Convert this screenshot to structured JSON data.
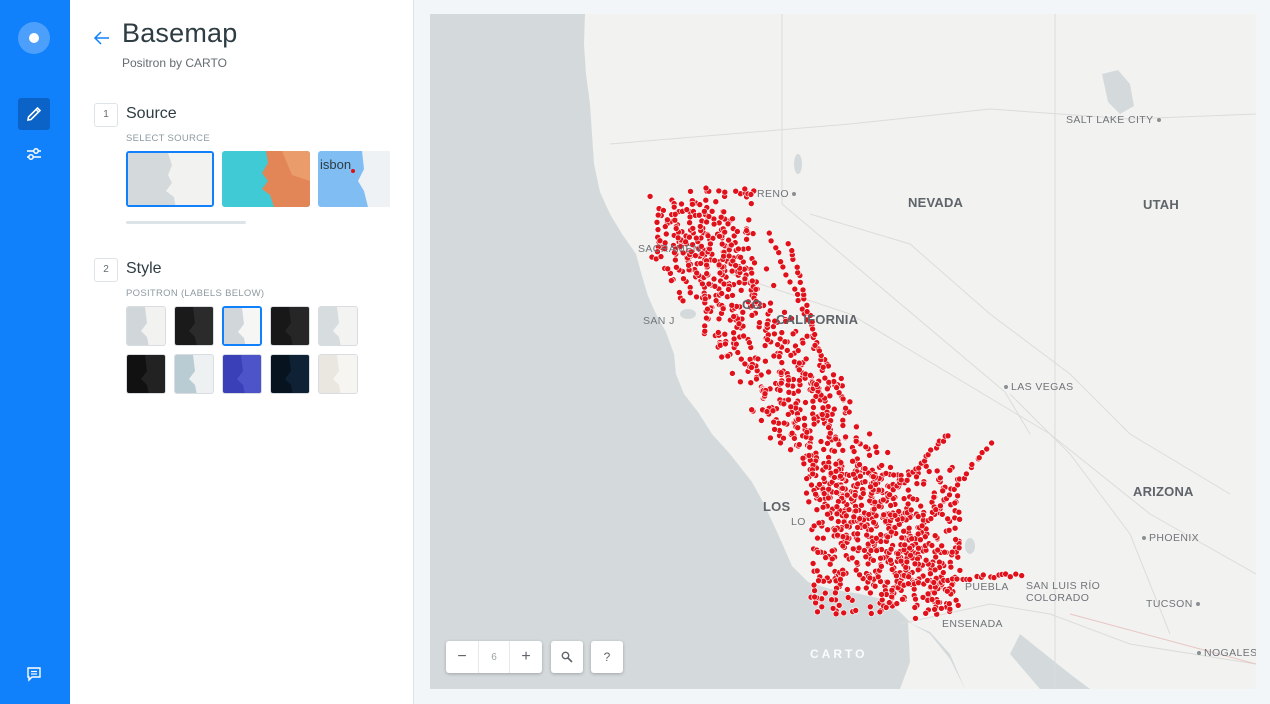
{
  "rail": {
    "items": [
      {
        "name": "style-editor",
        "icon": "pencil-icon",
        "active": true
      },
      {
        "name": "layer-settings",
        "icon": "sliders-icon",
        "active": false
      }
    ],
    "bottom_icon": "chat-icon"
  },
  "panel": {
    "title": "Basemap",
    "subtitle": "Positron by CARTO",
    "source": {
      "step": "1",
      "title": "Source",
      "subtitle": "SELECT SOURCE",
      "thumb_label": "isbon"
    },
    "style": {
      "step": "2",
      "title": "Style",
      "subtitle": "POSITRON (LABELS BELOW)"
    }
  },
  "map": {
    "labels": {
      "salt_lake_city": "SALT LAKE CITY",
      "reno": "RENO",
      "nevada": "NEVADA",
      "utah": "UTAH",
      "sacramento": "SACRAMEN",
      "california": "CALIFORNIA",
      "san_jose": "SAN J",
      "co": "CO",
      "las_vegas": "LAS VEGAS",
      "arizona": "ARIZONA",
      "los_angeles": "LOS",
      "lo": "LO",
      "phoenix": "PHOENIX",
      "san_luis_rio_colorado_1": "SAN LUIS RÍO",
      "san_luis_rio_colorado_2": "COLORADO",
      "puebla": "PUEBLA",
      "tucson": "TUCSON",
      "ensenada": "ENSENADA",
      "nogales": "NOGALES"
    },
    "zoom": "6",
    "help": "?",
    "attribution": "CARTO",
    "colors": {
      "points": "#e0111a",
      "land": "#f2f2f0",
      "water": "#d4dadc"
    }
  }
}
